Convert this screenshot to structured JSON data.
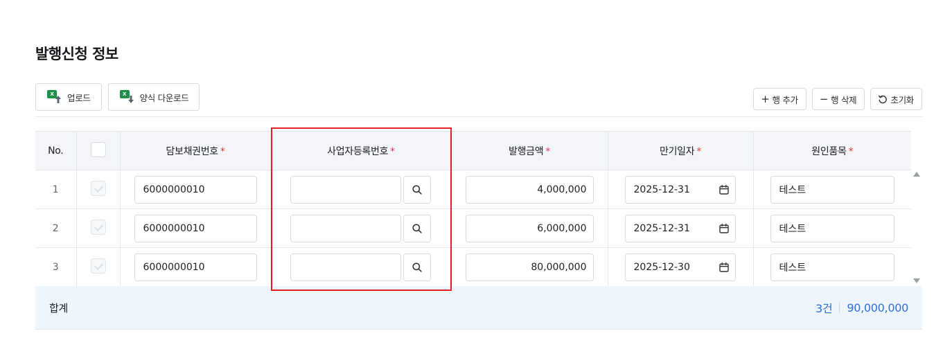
{
  "section": {
    "title": "발행신청 정보"
  },
  "toolbar": {
    "upload_label": "업로드",
    "template_download_label": "양식 다운로드",
    "add_row_label": "행 추가",
    "delete_row_label": "행 삭제",
    "reset_label": "초기화",
    "excel_badge": "X"
  },
  "table": {
    "columns": {
      "no": "No.",
      "collateral_bond_no": "담보채권번호",
      "business_reg_no": "사업자등록번호",
      "issue_amount": "발행금액",
      "maturity_date": "만기일자",
      "cause_item": "원인품목"
    },
    "required_mark": "*",
    "rows": [
      {
        "no": "1",
        "collateral_bond_no": "6000000010",
        "business_reg_no": "",
        "issue_amount": "4,000,000",
        "maturity_date": "2025-12-31",
        "cause_item": "테스트"
      },
      {
        "no": "2",
        "collateral_bond_no": "6000000010",
        "business_reg_no": "",
        "issue_amount": "6,000,000",
        "maturity_date": "2025-12-31",
        "cause_item": "테스트"
      },
      {
        "no": "3",
        "collateral_bond_no": "6000000010",
        "business_reg_no": "",
        "issue_amount": "80,000,000",
        "maturity_date": "2025-12-30",
        "cause_item": "테스트"
      }
    ]
  },
  "summary": {
    "label": "합계",
    "count": "3건",
    "total": "90,000,000"
  },
  "colors": {
    "required": "#e03b3b",
    "summary_text": "#2e6fd1",
    "highlight": "#e31e24",
    "excel": "#1f8f4a"
  }
}
